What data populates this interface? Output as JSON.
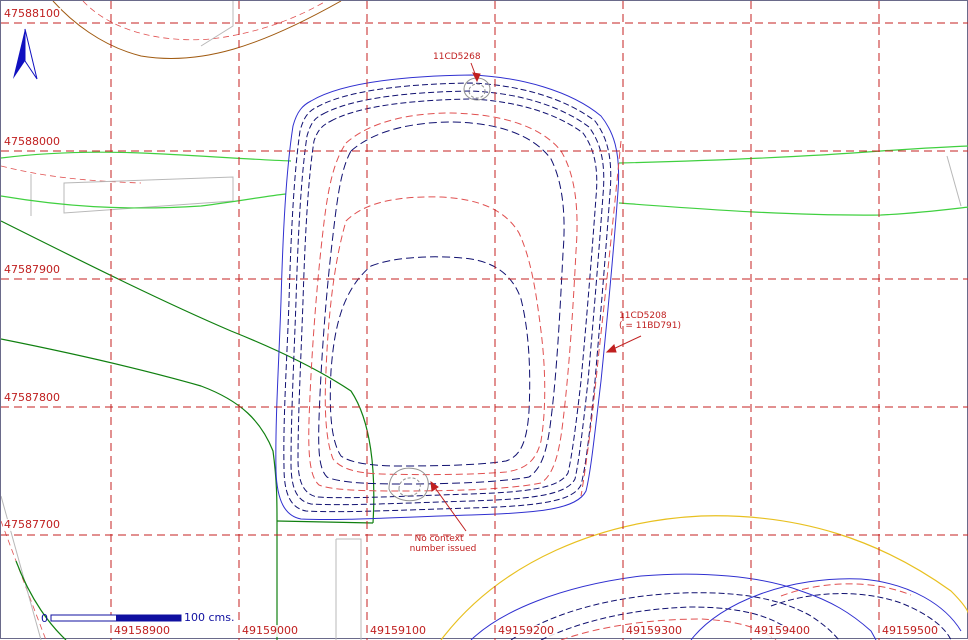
{
  "grid": {
    "northings": [
      "47588100",
      "47588000",
      "47587900",
      "47587800",
      "47587700"
    ],
    "eastings": [
      "49158900",
      "49159000",
      "49159100",
      "49159200",
      "49159300",
      "49159400",
      "49159500"
    ]
  },
  "annotations": {
    "small_feature": "11CD5268",
    "large_feature_line1": "11CD5208",
    "large_feature_line2": "( = 11BD791)",
    "no_context_line1": "No context",
    "no_context_line2": "number issued"
  },
  "scale_bar": {
    "start_label": "0",
    "end_label": "100 cms."
  },
  "north_arrow": {
    "icon": "north-arrow-icon"
  },
  "colors": {
    "grid": "#c42020",
    "contour_red": "#e05050",
    "contour_navy": "#101070",
    "contour_blue": "#3030d0",
    "green_line": "#40d040",
    "dark_green_line": "#108010",
    "brown_line": "#a05a10",
    "yellow_line": "#e8c020",
    "gray_line": "#b8b8b8"
  }
}
